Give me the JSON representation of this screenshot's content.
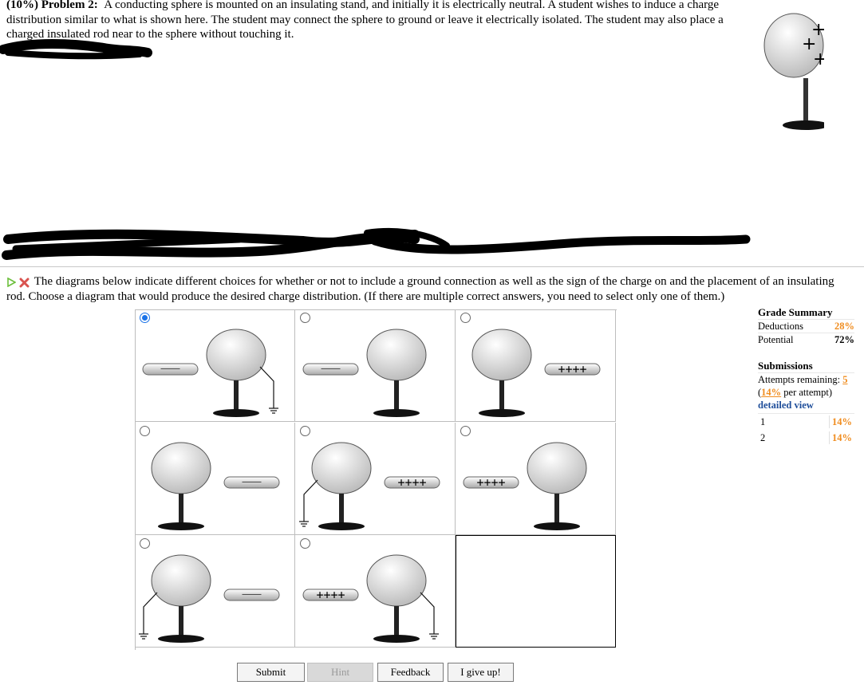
{
  "problem": {
    "label": "(10%) Problem 2:",
    "text": "A conducting sphere is mounted on an insulating stand, and initially it is electrically neutral. A student wishes to induce a charge distribution similar to what is shown here. The student may connect the sphere to ground or leave it electrically isolated. The student may also place a charged insulated rod near to the sphere without touching it."
  },
  "hero_signs": [
    "+",
    "+",
    "+"
  ],
  "question": {
    "text": "The diagrams below indicate different choices for whether or not to include a ground connection as well as the sign of the charge on and the placement of an insulating rod. Choose a diagram that would produce the desired charge distribution. (If there are multiple correct answers, you need to select only one of them.)"
  },
  "options": [
    {
      "id": "a",
      "selected": true,
      "rod": "————",
      "rod_sign": "negative",
      "rod_side": "left",
      "ground": true
    },
    {
      "id": "b",
      "selected": false,
      "rod": "————",
      "rod_sign": "negative",
      "rod_side": "left",
      "ground": false
    },
    {
      "id": "c",
      "selected": false,
      "rod": "++++",
      "rod_sign": "positive",
      "rod_side": "right",
      "ground": false
    },
    {
      "id": "d",
      "selected": false,
      "rod": "————",
      "rod_sign": "negative",
      "rod_side": "right",
      "ground": false
    },
    {
      "id": "e",
      "selected": false,
      "rod": "++++",
      "rod_sign": "positive",
      "rod_side": "right",
      "ground": true
    },
    {
      "id": "f",
      "selected": false,
      "rod": "++++",
      "rod_sign": "positive",
      "rod_side": "left",
      "ground": false
    },
    {
      "id": "g",
      "selected": false,
      "rod": "————",
      "rod_sign": "negative",
      "rod_side": "right",
      "ground": true
    },
    {
      "id": "h",
      "selected": false,
      "rod": "++++",
      "rod_sign": "positive",
      "rod_side": "left",
      "ground": true
    }
  ],
  "summary": {
    "title": "Grade Summary",
    "deductions_label": "Deductions",
    "deductions_value": "28%",
    "potential_label": "Potential",
    "potential_value": "72%",
    "submissions_title": "Submissions",
    "attempts_label": "Attempts remaining:",
    "attempts_value": "5",
    "per_attempt_open": "(",
    "per_attempt_pct": "14%",
    "per_attempt_rest": " per attempt)",
    "detailed_view": "detailed view",
    "attempts": [
      {
        "n": "1",
        "pct": "14%"
      },
      {
        "n": "2",
        "pct": "14%"
      }
    ]
  },
  "buttons": {
    "submit": "Submit",
    "hint": "Hint",
    "feedback": "Feedback",
    "give_up": "I give up!"
  },
  "colors": {
    "radio_selected": "#1a73e8",
    "orange": "#f08c1e",
    "link_blue": "#1f4e9a",
    "check_green": "#6cbf3c",
    "cross_red": "#d9534f"
  }
}
